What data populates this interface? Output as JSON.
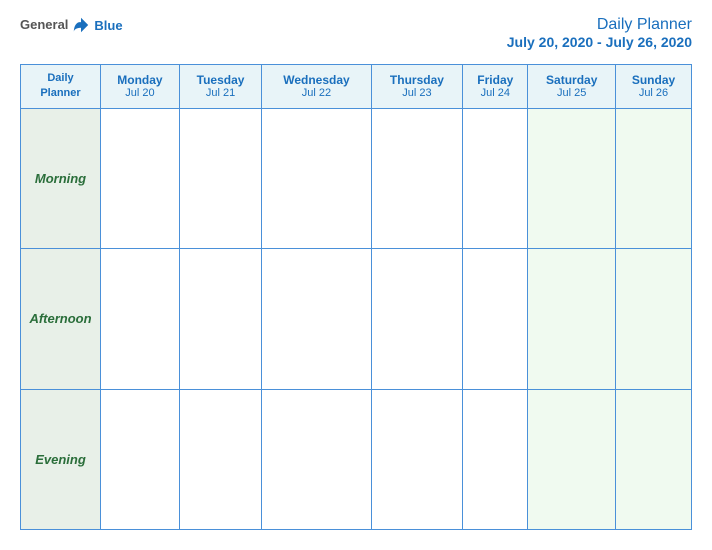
{
  "header": {
    "logo": {
      "general": "General",
      "blue": "Blue",
      "icon_unicode": "▶"
    },
    "title": "Daily Planner",
    "date_range": "July 20, 2020 - July 26, 2020"
  },
  "table": {
    "header_label_line1": "Daily",
    "header_label_line2": "Planner",
    "columns": [
      {
        "day": "Monday",
        "date": "Jul 20"
      },
      {
        "day": "Tuesday",
        "date": "Jul 21"
      },
      {
        "day": "Wednesday",
        "date": "Jul 22"
      },
      {
        "day": "Thursday",
        "date": "Jul 23"
      },
      {
        "day": "Friday",
        "date": "Jul 24"
      },
      {
        "day": "Saturday",
        "date": "Jul 25"
      },
      {
        "day": "Sunday",
        "date": "Jul 26"
      }
    ],
    "rows": [
      {
        "label": "Morning"
      },
      {
        "label": "Afternoon"
      },
      {
        "label": "Evening"
      }
    ]
  }
}
